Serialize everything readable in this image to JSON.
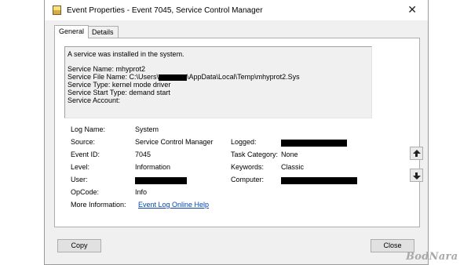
{
  "window": {
    "title": "Event Properties - Event 7045, Service Control Manager",
    "title_icon": "event-viewer-icon",
    "close_glyph": "✕"
  },
  "tabs": [
    {
      "label": "General",
      "active": true
    },
    {
      "label": "Details",
      "active": false
    }
  ],
  "description": {
    "line1": "A service was installed in the system.",
    "service_name": "Service Name:  mhyprot2",
    "file_name_prefix": "Service File Name:  C:\\Users\\",
    "file_name_suffix": "\\AppData\\Local\\Temp\\mhyprot2.Sys",
    "service_type": "Service Type:  kernel mode driver",
    "start_type": "Service Start Type:  demand start",
    "account": "Service Account:"
  },
  "fields": {
    "log_name_label": "Log Name:",
    "log_name_value": "System",
    "source_label": "Source:",
    "source_value": "Service Control Manager",
    "logged_label": "Logged:",
    "event_id_label": "Event ID:",
    "event_id_value": "7045",
    "task_category_label": "Task Category:",
    "task_category_value": "None",
    "level_label": "Level:",
    "level_value": "Information",
    "keywords_label": "Keywords:",
    "keywords_value": "Classic",
    "user_label": "User:",
    "computer_label": "Computer:",
    "opcode_label": "OpCode:",
    "opcode_value": "Info",
    "more_info_label": "More Information:",
    "more_info_link": "Event Log Online Help"
  },
  "nav": {
    "up_icon": "arrow-up-icon",
    "down_icon": "arrow-down-icon"
  },
  "buttons": {
    "copy": "Copy",
    "close": "Close"
  },
  "watermark": "BodNara",
  "colors": {
    "window_bg": "#f0f0f0",
    "link": "#0645ad",
    "redaction": "#000000"
  }
}
